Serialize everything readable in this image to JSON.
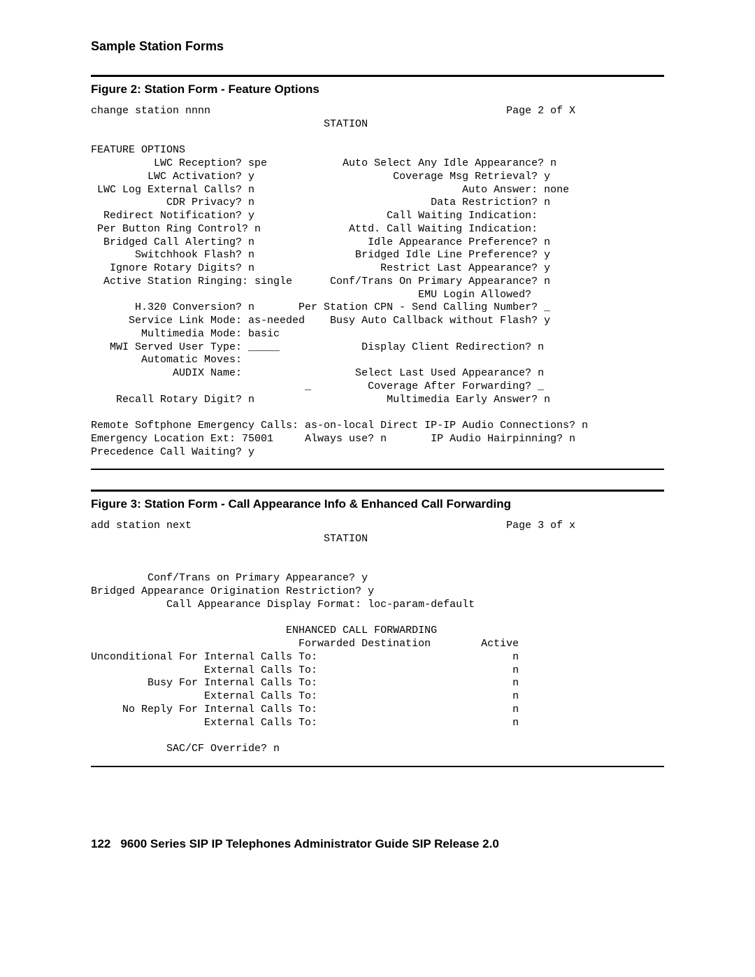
{
  "header": {
    "section_title": "Sample Station Forms"
  },
  "figure2": {
    "caption": "Figure 2: Station Form - Feature Options",
    "body": "change station nnnn                                               Page 2 of X\n                                     STATION\n\nFEATURE OPTIONS\n          LWC Reception? spe            Auto Select Any Idle Appearance? n\n         LWC Activation? y                      Coverage Msg Retrieval? y\n LWC Log External Calls? n                                 Auto Answer: none\n            CDR Privacy? n                            Data Restriction? n\n  Redirect Notification? y                     Call Waiting Indication:\n Per Button Ring Control? n              Attd. Call Waiting Indication:\n  Bridged Call Alerting? n                  Idle Appearance Preference? n\n       Switchhook Flash? n                Bridged Idle Line Preference? y\n   Ignore Rotary Digits? n                    Restrict Last Appearance? y\n  Active Station Ringing: single      Conf/Trans On Primary Appearance? n\n                                                    EMU Login Allowed?\n       H.320 Conversion? n       Per Station CPN - Send Calling Number? _\n      Service Link Mode: as-needed    Busy Auto Callback without Flash? y\n        Multimedia Mode: basic\n   MWI Served User Type: _____             Display Client Redirection? n\n        Automatic Moves:\n             AUDIX Name:                  Select Last Used Appearance? n\n                                  _         Coverage After Forwarding? _\n    Recall Rotary Digit? n                     Multimedia Early Answer? n\n\nRemote Softphone Emergency Calls: as-on-local Direct IP-IP Audio Connections? n\nEmergency Location Ext: 75001     Always use? n       IP Audio Hairpinning? n\nPrecedence Call Waiting? y"
  },
  "figure3": {
    "caption": "Figure 3: Station Form - Call Appearance Info & Enhanced Call Forwarding",
    "body": "add station next                                                  Page 3 of x\n                                     STATION\n\n\n         Conf/Trans on Primary Appearance? y\nBridged Appearance Origination Restriction? y\n            Call Appearance Display Format: loc-param-default\n\n                               ENHANCED CALL FORWARDING\n                                 Forwarded Destination        Active\nUnconditional For Internal Calls To:                               n\n                  External Calls To:                               n\n         Busy For Internal Calls To:                               n\n                  External Calls To:                               n\n     No Reply For Internal Calls To:                               n\n                  External Calls To:                               n\n\n            SAC/CF Override? n"
  },
  "footer": {
    "page_number": "122",
    "doc_title": "9600 Series SIP IP Telephones Administrator Guide SIP Release 2.0"
  }
}
